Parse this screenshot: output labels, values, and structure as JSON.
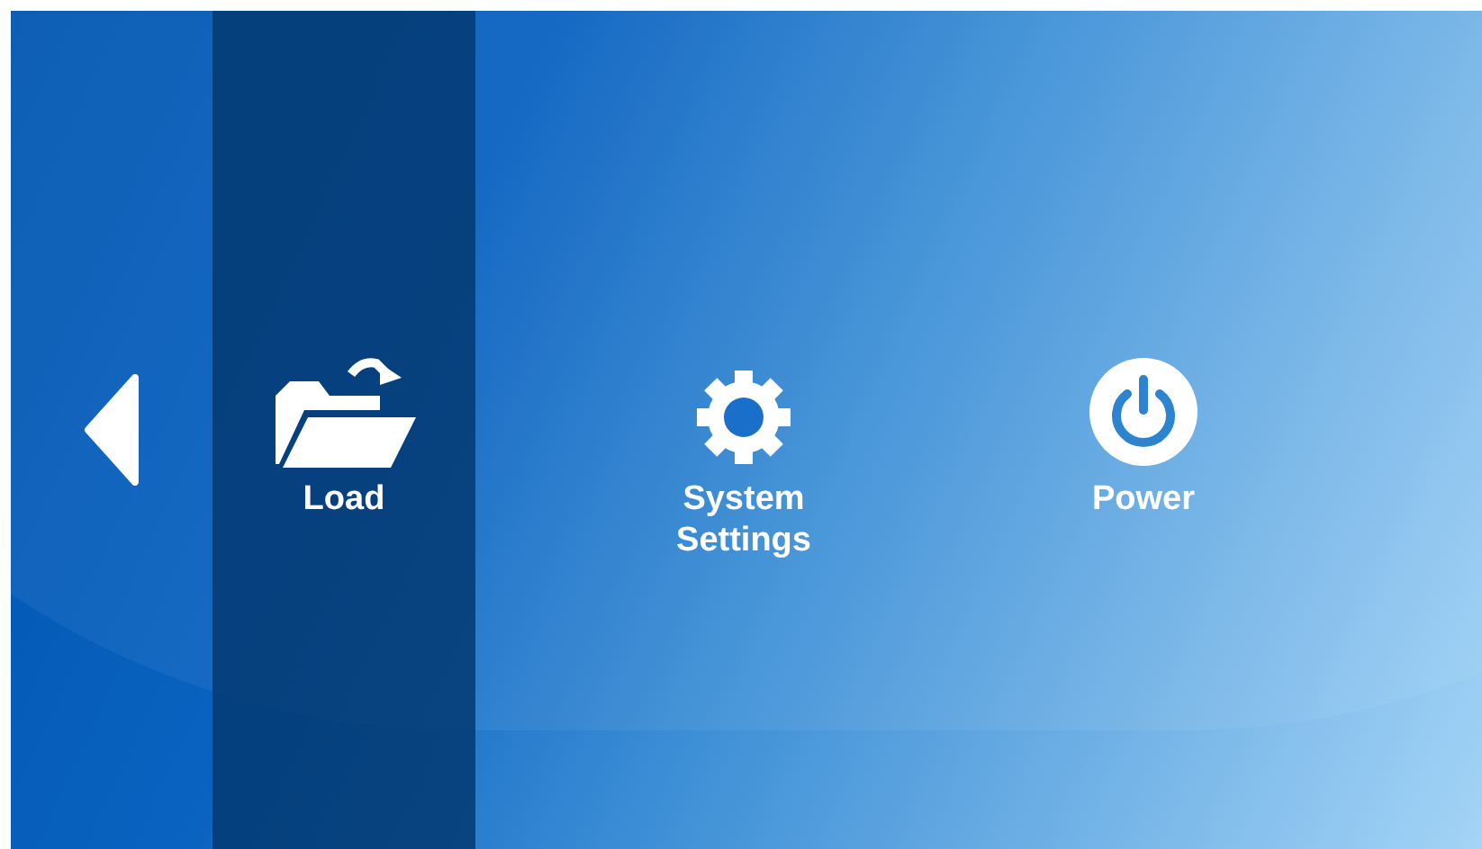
{
  "menu": {
    "items": [
      {
        "kind": "load",
        "label": "Load",
        "selected": true
      },
      {
        "kind": "settings",
        "label": "System Settings",
        "selected": false
      },
      {
        "kind": "power",
        "label": "Power",
        "selected": false
      }
    ]
  }
}
